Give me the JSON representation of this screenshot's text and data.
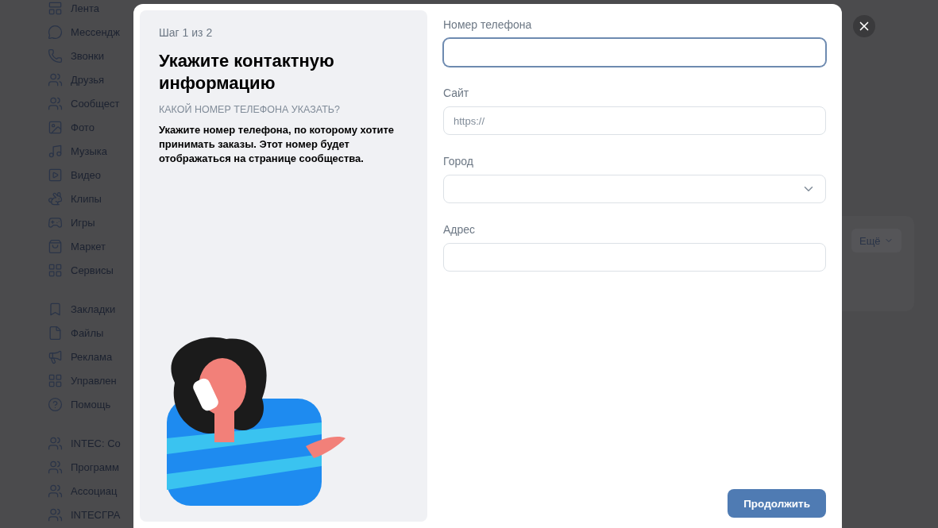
{
  "sidebar": {
    "groups": [
      [
        {
          "label": "Лента"
        },
        {
          "label": "Мессендж"
        },
        {
          "label": "Звонки"
        },
        {
          "label": "Друзья"
        },
        {
          "label": "Сообщест"
        },
        {
          "label": "Фото"
        },
        {
          "label": "Музыка"
        },
        {
          "label": "Видео"
        },
        {
          "label": "Клипы"
        },
        {
          "label": "Игры"
        },
        {
          "label": "Маркет"
        },
        {
          "label": "Сервисы"
        }
      ],
      [
        {
          "label": "Закладки"
        },
        {
          "label": "Файлы"
        },
        {
          "label": "Реклама"
        },
        {
          "label": "Управлен"
        },
        {
          "label": "Помощь"
        }
      ],
      [
        {
          "label": "INTEC: Со"
        },
        {
          "label": "Программ"
        },
        {
          "label": "Ассоциац"
        },
        {
          "label": "INTECГРА"
        }
      ]
    ]
  },
  "dialog": {
    "step": "Шаг 1 из 2",
    "title": "Укажите контактную информацию",
    "question": "КАКОЙ НОМЕР ТЕЛЕФОНА УКАЗАТЬ?",
    "description": "Укажите номер телефона, по которому хотите принимать заказы. Этот номер будет отображаться на странице сообщества.",
    "fields": [
      {
        "kind": "text",
        "label": "Номер телефона",
        "focused": true
      },
      {
        "kind": "text",
        "label": "Сайт",
        "placeholder": "https://",
        "focused": false
      },
      {
        "kind": "select",
        "label": "Город",
        "focused": false
      },
      {
        "kind": "text",
        "label": "Адрес",
        "focused": false
      }
    ],
    "continue_button": "Продолжить"
  },
  "background": {
    "more_button": "Ещё"
  }
}
